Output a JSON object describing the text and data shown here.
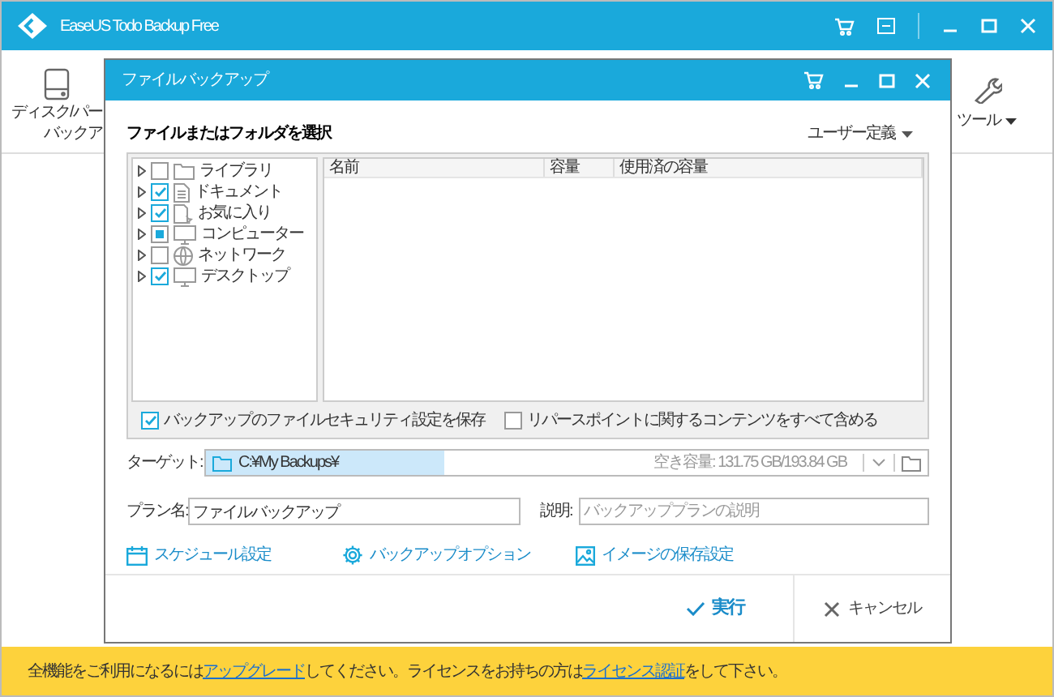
{
  "app": {
    "title": "EaseUS Todo Backup Free",
    "toolbar_left": [
      "ディスク/パー",
      "バックア"
    ],
    "tools_label": "ツール"
  },
  "dialog": {
    "title": "ファイルバックアップ",
    "section_title": "ファイルまたはフォルダを選択",
    "view_menu": "ユーザー定義",
    "tree": [
      {
        "label": "ライブラリ",
        "kind": "folder",
        "checked": false,
        "partial": false
      },
      {
        "label": "ドキュメント",
        "kind": "document",
        "checked": true,
        "partial": false
      },
      {
        "label": "お気に入り",
        "kind": "favorites",
        "checked": true,
        "partial": false
      },
      {
        "label": "コンピューター",
        "kind": "computer",
        "checked": false,
        "partial": true
      },
      {
        "label": "ネットワーク",
        "kind": "network",
        "checked": false,
        "partial": false
      },
      {
        "label": "デスクトップ",
        "kind": "computer",
        "checked": true,
        "partial": false
      }
    ],
    "columns": [
      "名前",
      "容量",
      "使用済の容量"
    ],
    "options": [
      {
        "label": "バックアップのファイルセキュリティ設定を保存",
        "checked": true
      },
      {
        "label": "リパースポイントに関するコンテンツをすべて含める",
        "checked": false
      }
    ],
    "target": {
      "label": "ターゲット:",
      "value": "C:¥My Backups¥",
      "free_space": "空き容量: 131.75 GB/193.84 GB",
      "level": 0.33
    },
    "plan": {
      "label": "プラン名:",
      "value": "ファイルバックアップ"
    },
    "description": {
      "label": "説明:",
      "placeholder": "バックアッププランの説明"
    },
    "links": [
      {
        "label": "スケジュール設定",
        "kind": "calendar"
      },
      {
        "label": "バックアップオプション",
        "kind": "gear"
      },
      {
        "label": "イメージの保存設定",
        "kind": "image"
      }
    ],
    "ok": "実行",
    "cancel": "キャンセル"
  },
  "banner": {
    "text_1": "全機能をご利用になるには",
    "link_1": "アップグレード",
    "text_2": "してください。ライセンスをお持ちの方は",
    "link_2": "ライセンス認証",
    "text_3": "をして下さい。"
  }
}
